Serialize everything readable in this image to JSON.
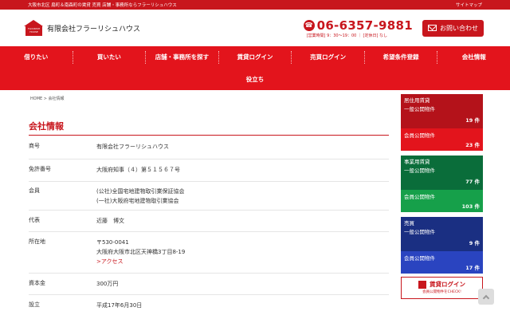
{
  "topbar": {
    "tagline": "大阪市北区 扇町＆南森町の賃貸 売買 店舗・事務所ならフラーリシュハウス",
    "sitemap": "サイトマップ"
  },
  "header": {
    "logo_text": "FLOURISH HOUSE",
    "company_name": "有限会社フラーリシュハウス",
    "phone": "06-6357-9881",
    "hours": "[営業時間] 9：30〜19：00 ｜ [定休日] なし",
    "inquiry_label": "お問い合わせ"
  },
  "nav": {
    "items": [
      "借りたい",
      "買いたい",
      "店舗・事務所を探す",
      "賃貸ログイン",
      "売買ログイン",
      "希望条件登録",
      "会社情報"
    ],
    "row2": [
      "役立ち"
    ]
  },
  "breadcrumb": "HOME > 会社情報",
  "page_title": "会社情報",
  "company_info": [
    {
      "label": "商号",
      "lines": [
        "有限会社フラーリシュハウス"
      ]
    },
    {
      "label": "免許番号",
      "lines": [
        "大阪府知事（４）第５１５６７号"
      ]
    },
    {
      "label": "会員",
      "lines": [
        "(公社)全国宅地建物取引業保証協会",
        "(一社)大阪府宅地建物取引業協会"
      ]
    },
    {
      "label": "代表",
      "lines": [
        "近藤　博文"
      ]
    },
    {
      "label": "所在地",
      "lines": [
        "〒530-0041",
        "大阪府大阪市北区天神橋3丁目8-19"
      ],
      "link": ">アクセス"
    },
    {
      "label": "資本金",
      "lines": [
        "300万円"
      ]
    },
    {
      "label": "設立",
      "lines": [
        "平成17年6月30日"
      ]
    }
  ],
  "sidebar": {
    "groups": [
      {
        "title_lines": [
          "居住用賃貸",
          "一般公開物件"
        ],
        "count": "19 件",
        "member_label": "会員公開物件",
        "member_count": "23 件",
        "head_color": "#b4121a",
        "member_color": "#e3141c"
      },
      {
        "title_lines": [
          "事業用賃貸",
          "一般公開物件"
        ],
        "count": "77 件",
        "member_label": "会員公開物件",
        "member_count": "103 件",
        "head_color": "#0a6d3a",
        "member_color": "#16a04a"
      },
      {
        "title_lines": [
          "売買",
          "一般公開物件"
        ],
        "count": "9 件",
        "member_label": "会員公開物件",
        "member_count": "17 件",
        "head_color": "#1a2f82",
        "member_color": "#2a44c0"
      }
    ],
    "login_title": "賃貸ログイン",
    "login_sub": "会員公開物件をCHECK!"
  }
}
